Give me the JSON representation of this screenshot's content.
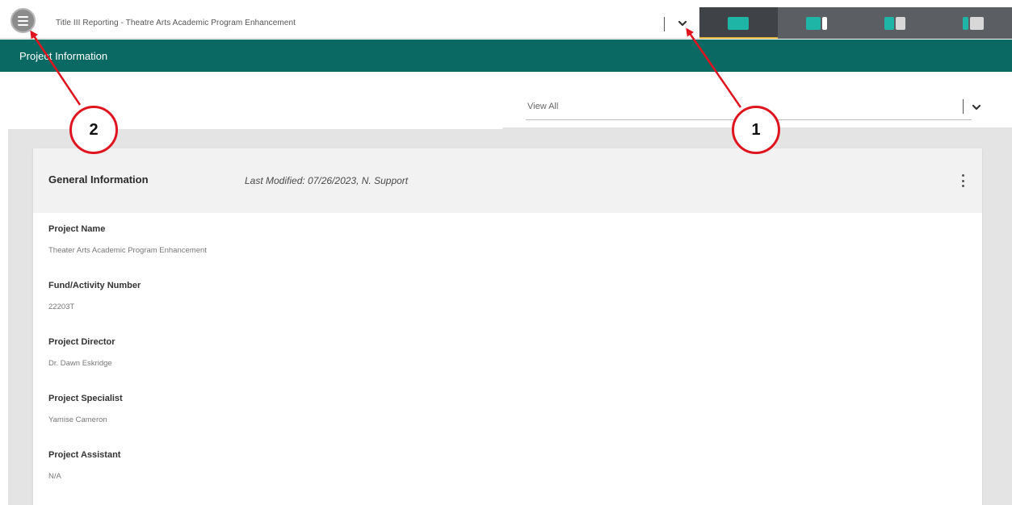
{
  "topbar": {
    "menu_icon": "hamburger-menu-icon",
    "title": "Title III Reporting - Theatre Arts Academic Program Enhancement",
    "dropdown_icon": "chevron-down-icon",
    "layout_tabs": [
      {
        "icon": "layout-full-icon",
        "active": true
      },
      {
        "icon": "layout-wide-left-icon",
        "active": false
      },
      {
        "icon": "layout-split-icon",
        "active": false
      },
      {
        "icon": "layout-narrow-left-icon",
        "active": false
      }
    ]
  },
  "section": {
    "title": "Project Information"
  },
  "filter": {
    "value": "View All",
    "dropdown_icon": "chevron-down-icon"
  },
  "card": {
    "title": "General Information",
    "last_modified": "Last Modified: 07/26/2023, N. Support",
    "menu_icon": "kebab-menu-icon",
    "fields": [
      {
        "label": "Project Name",
        "value": "Theater Arts Academic Program Enhancement"
      },
      {
        "label": "Fund/Activity Number",
        "value": "22203T"
      },
      {
        "label": "Project Director",
        "value": "Dr. Dawn Eskridge"
      },
      {
        "label": "Project Specialist",
        "value": "Yamise Cameron"
      },
      {
        "label": "Project Assistant",
        "value": "N/A"
      }
    ]
  },
  "annotations": {
    "callout_1": "1",
    "callout_2": "2",
    "color": "#e0141e"
  },
  "colors": {
    "accent_teal": "#0a6a63",
    "tab_active_underline": "#e2b23e",
    "layout_icon_teal": "#1fb5a6"
  }
}
